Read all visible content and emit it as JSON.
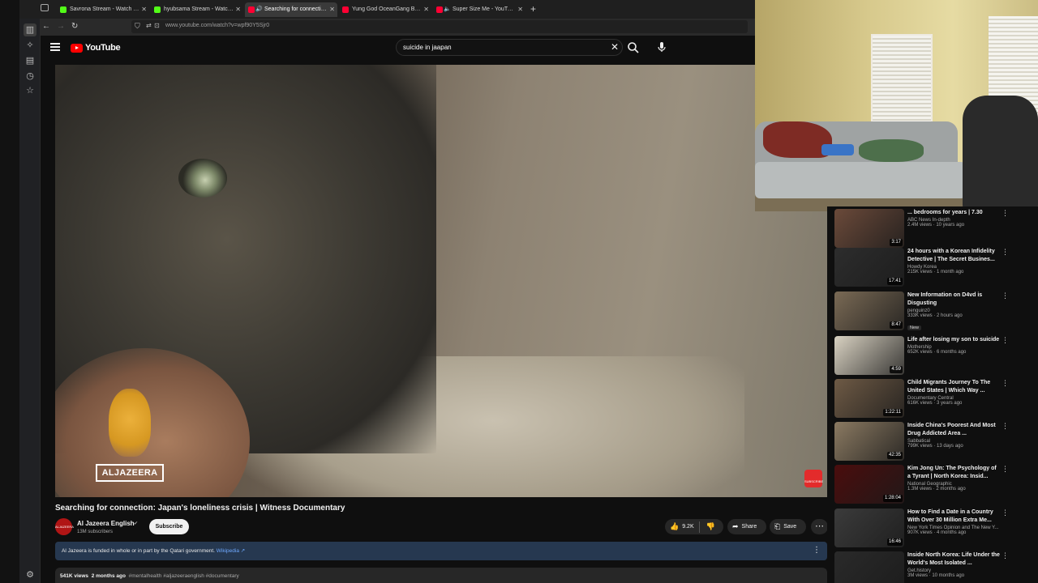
{
  "browser": {
    "tabs": [
      {
        "title": "Savrona Stream - Watch Live o",
        "favicon_color": "#53fc18",
        "active": false
      },
      {
        "title": "hyubsama Stream - Watch Live",
        "favicon_color": "#53fc18",
        "active": false
      },
      {
        "title": "Searching for connection: J",
        "favicon_color": "#ff0033",
        "active": true
      },
      {
        "title": "Yung God OceanGang Based F",
        "favicon_color": "#ff0033",
        "active": false
      },
      {
        "title": "Super Size Me - YouTube",
        "favicon_color": "#ff0033",
        "active": false
      }
    ],
    "new_tab_label": "+",
    "url": "www.youtube.com/watch?v=wpf90Y5Sjr0"
  },
  "youtube": {
    "logo_text": "YouTube",
    "search_value": "suicide in jaapan"
  },
  "video": {
    "watermark_text": "ALJAZEERA",
    "subscribe_watermark": "SUBSCRIBE",
    "title": "Searching for connection: Japan's loneliness crisis | Witness Documentary",
    "channel": {
      "name": "Al Jazeera English",
      "subscribers": "13M subscribers",
      "avatar_text": "ALJAZEERA"
    },
    "subscribe_label": "Subscribe",
    "likes": "9.2K",
    "share_label": "Share",
    "save_label": "Save",
    "funding_text": "Al Jazeera is funded in whole or in part by the Qatari government.",
    "funding_link": "Wikipedia ↗",
    "views": "541K views",
    "age": "2 months ago",
    "tags": "#mentalhealth #aljazeeraenglish #documentary"
  },
  "recommendations": [
    {
      "title": "... bedrooms for years | 7.30",
      "channel": "ABC News In-depth",
      "meta": "2.4M views · 10 years ago",
      "duration": "3:17",
      "badge": "",
      "thumb_color": "#6b4a3a"
    },
    {
      "title": "24 hours with a Korean Infidelity Detective | The Secret Busines...",
      "channel": "Howdy Korea",
      "meta": "215K views · 1 month ago",
      "duration": "17:41",
      "badge": "",
      "thumb_color": "#2d2d2d"
    },
    {
      "title": "New Information on D4vd is Disgusting",
      "channel": "penguinz0",
      "meta": "333K views · 2 hours ago",
      "duration": "8:47",
      "badge": "New",
      "thumb_color": "#7a6a55"
    },
    {
      "title": "Life after losing my son to suicide",
      "channel": "Mothership",
      "meta": "652K views · 6 months ago",
      "duration": "4:59",
      "badge": "",
      "thumb_color": "#d9d2c2"
    },
    {
      "title": "Child Migrants Journey To The United States | Which Way ...",
      "channel": "Documentary Central",
      "meta": "616K views · 3 years ago",
      "duration": "1:22:11",
      "badge": "",
      "thumb_color": "#6e5a45"
    },
    {
      "title": "Inside China's Poorest And Most Drug Addicted Area ...",
      "channel": "Sabbatical",
      "meta": "799K views · 13 days ago",
      "duration": "42:35",
      "badge": "",
      "thumb_color": "#8b7a62"
    },
    {
      "title": "Kim Jong Un: The Psychology of a Tyrant | North Korea: Insid...",
      "channel": "National Geographic",
      "meta": "1.3M views · 2 months ago",
      "duration": "1:28:04",
      "badge": "",
      "thumb_color": "#4a0d0d"
    },
    {
      "title": "How to Find a Date in a Country With Over 30 Million Extra Me...",
      "channel": "New York Times Opinion and The New Y...",
      "meta": "907K views · 4 months ago",
      "duration": "16:46",
      "badge": "",
      "thumb_color": "#3b3b3b"
    },
    {
      "title": "Inside North Korea: Life Under the World's Most Isolated ...",
      "channel": "Get.history",
      "meta": "3M views · 10 months ago",
      "duration": "",
      "badge": "",
      "thumb_color": "#2a2a2a"
    }
  ]
}
